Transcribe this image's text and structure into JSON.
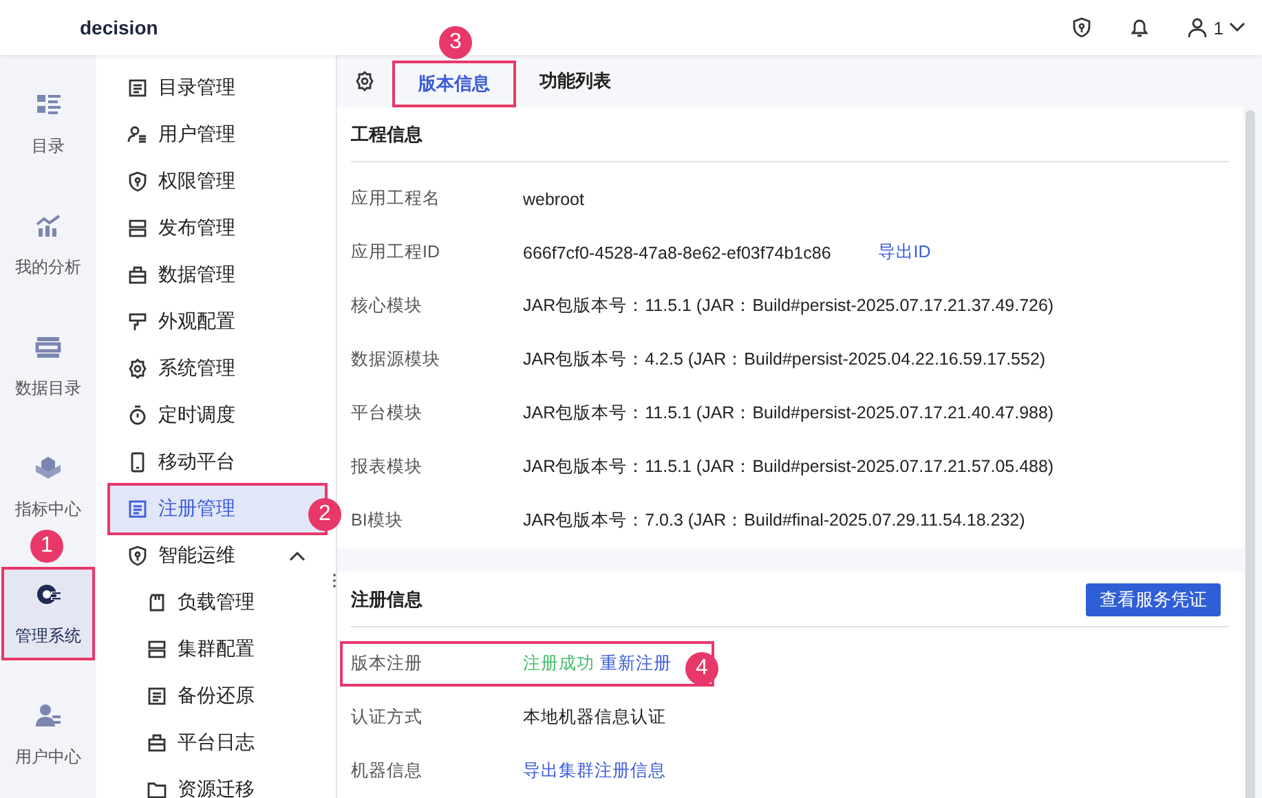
{
  "topbar": {
    "title": "decision",
    "user": "1"
  },
  "rail": [
    {
      "label": "目录",
      "selected": false,
      "highlighted": false
    },
    {
      "label": "我的分析",
      "selected": false,
      "highlighted": false
    },
    {
      "label": "数据目录",
      "selected": false,
      "highlighted": false
    },
    {
      "label": "指标中心",
      "selected": false,
      "highlighted": false
    },
    {
      "label": "管理系统",
      "selected": true,
      "highlighted": true,
      "callout": "1"
    },
    {
      "label": "用户中心",
      "selected": false,
      "highlighted": false
    }
  ],
  "nav": [
    {
      "label": "目录管理",
      "selected": false,
      "highlighted": false
    },
    {
      "label": "用户管理",
      "selected": false,
      "highlighted": false
    },
    {
      "label": "权限管理",
      "selected": false,
      "highlighted": false
    },
    {
      "label": "发布管理",
      "selected": false,
      "highlighted": false
    },
    {
      "label": "数据管理",
      "selected": false,
      "highlighted": false
    },
    {
      "label": "外观配置",
      "selected": false,
      "highlighted": false
    },
    {
      "label": "系统管理",
      "selected": false,
      "highlighted": false
    },
    {
      "label": "定时调度",
      "selected": false,
      "highlighted": false
    },
    {
      "label": "移动平台",
      "selected": false,
      "highlighted": false
    },
    {
      "label": "注册管理",
      "selected": true,
      "highlighted": true,
      "callout": "2"
    },
    {
      "label": "智能运维",
      "selected": false,
      "highlighted": false,
      "expanded": true,
      "children": [
        {
          "label": "负载管理",
          "selected": false
        },
        {
          "label": "集群配置",
          "selected": false
        },
        {
          "label": "备份还原",
          "selected": false
        },
        {
          "label": "平台日志",
          "selected": false
        },
        {
          "label": "资源迁移",
          "selected": false
        }
      ]
    }
  ],
  "tabs": [
    {
      "label": "版本信息",
      "selected": true,
      "highlighted": true,
      "callout": "3"
    },
    {
      "label": "功能列表",
      "selected": false,
      "highlighted": false
    }
  ],
  "sections": [
    {
      "title": "工程信息",
      "rows": [
        {
          "label": "应用工程名",
          "value": "webroot"
        },
        {
          "label": "应用工程ID",
          "value": "666f7cf0-4528-47a8-8e62-ef03f74b1c86",
          "link": "导出ID"
        },
        {
          "label": "核心模块",
          "value": "JAR包版本号：11.5.1 (JAR：Build#persist-2025.07.17.21.37.49.726)"
        },
        {
          "label": "数据源模块",
          "value": "JAR包版本号：4.2.5 (JAR：Build#persist-2025.04.22.16.59.17.552)"
        },
        {
          "label": "平台模块",
          "value": "JAR包版本号：11.5.1 (JAR：Build#persist-2025.07.17.21.40.47.988)"
        },
        {
          "label": "报表模块",
          "value": "JAR包版本号：11.5.1 (JAR：Build#persist-2025.07.17.21.57.05.488)"
        },
        {
          "label": "BI模块",
          "value": "JAR包版本号：7.0.3 (JAR：Build#final-2025.07.29.11.54.18.232)"
        }
      ]
    },
    {
      "title": "注册信息",
      "button": "查看服务凭证",
      "rows": [
        {
          "label": "版本注册",
          "status": "注册成功",
          "link": "重新注册",
          "highlighted": true,
          "callout": "4"
        },
        {
          "label": "认证方式",
          "value": "本地机器信息认证"
        },
        {
          "label": "机器信息",
          "link": "导出集群注册信息"
        }
      ]
    }
  ]
}
